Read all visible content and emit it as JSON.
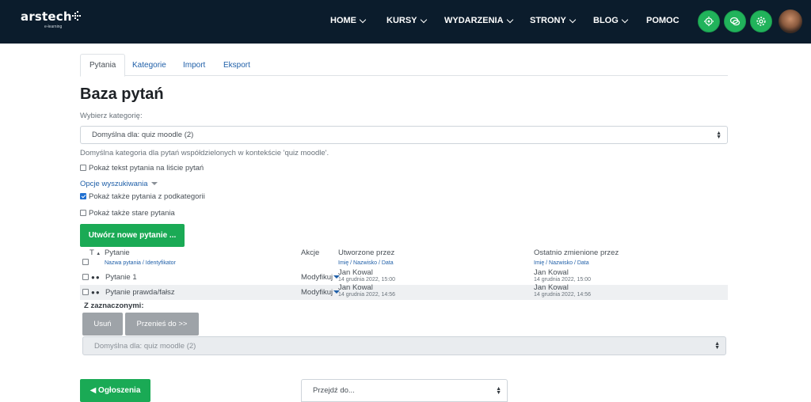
{
  "logo": {
    "text": "arstech",
    "sub": "e-learning"
  },
  "nav": {
    "items": [
      {
        "label": "HOME"
      },
      {
        "label": "KURSY"
      },
      {
        "label": "WYDARZENIA"
      },
      {
        "label": "STRONY"
      },
      {
        "label": "BLOG"
      },
      {
        "label": "POMOC"
      }
    ],
    "icons": [
      "support-icon",
      "chat-icon",
      "gear-icon"
    ],
    "accent": "#21b35b",
    "bg": "#0b1c2c"
  },
  "tabs": [
    {
      "label": "Pytania"
    },
    {
      "label": "Kategorie"
    },
    {
      "label": "Import"
    },
    {
      "label": "Eksport"
    }
  ],
  "page_title": "Baza pytań",
  "category": {
    "label": "Wybierz kategorię:",
    "selected": "Domyślna dla: quiz moodle (2)",
    "description": "Domyślna kategoria dla pytań współdzielonych w kontekście 'quiz moodle'."
  },
  "options": {
    "show_text": "Pokaż tekst pytania na liście pytań",
    "search_options": "Opcje wyszukiwania",
    "show_sub": "Pokaż także pytania z podkategorii",
    "show_old": "Pokaż także stare pytania"
  },
  "create_button": "Utwórz nowe pytanie ...",
  "table": {
    "col_t": "T",
    "col_question": "Pytanie",
    "col_question_sub": "Nazwa pytania / Identyfikator",
    "col_actions": "Akcje",
    "col_created": "Utworzone przez",
    "col_created_sub": "Imię / Nazwisko / Data",
    "col_modified": "Ostatnio zmienione przez",
    "col_modified_sub": "Imię / Nazwisko / Data",
    "rows": [
      {
        "name": "Pytanie 1",
        "action": "Modyfikuj",
        "created_by": "Jan Kowal",
        "created_date": "14 grudnia 2022, 15:00",
        "modified_by": "Jan Kowal",
        "modified_date": "14 grudnia 2022, 15:00"
      },
      {
        "name": "Pytanie prawda/fałsz",
        "action": "Modyfikuj",
        "created_by": "Jan Kowal",
        "created_date": "14 grudnia 2022, 14:56",
        "modified_by": "Jan Kowal",
        "modified_date": "14 grudnia 2022, 14:56"
      }
    ]
  },
  "bulk": {
    "label": "Z zaznaczonymi:",
    "delete": "Usuń",
    "move": "Przenieś do >>",
    "target": "Domyślna dla: quiz moodle (2)"
  },
  "footer": {
    "announcements": "◀ Ogłoszenia",
    "jump": "Przejdź do..."
  }
}
